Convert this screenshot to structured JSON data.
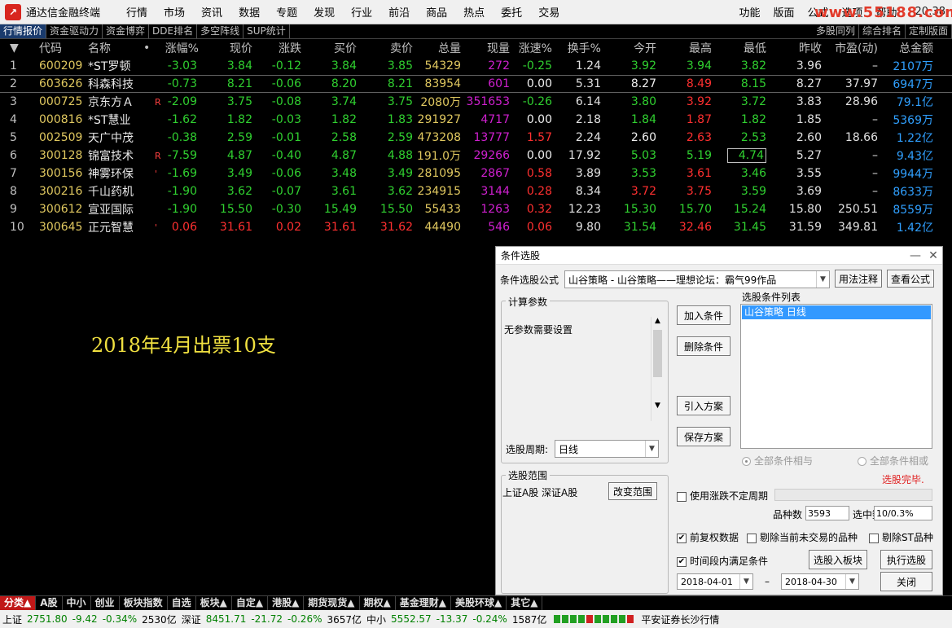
{
  "titlebar": {
    "app_title": "通达信金融终端",
    "menu": [
      "行情",
      "市场",
      "资讯",
      "数据",
      "专题",
      "发现",
      "行业",
      "前沿",
      "商品",
      "热点",
      "委托",
      "交易"
    ],
    "menu_right": [
      "功能",
      "版面",
      "公式",
      "选项",
      "帮助"
    ],
    "clock": "20:38",
    "watermark": "www.55188.com"
  },
  "tabs": {
    "left": [
      "行情报价",
      "资金驱动力",
      "资金博弈",
      "DDE排名",
      "多空阵线",
      "SUP统计"
    ],
    "right": [
      "多股同列",
      "综合排名",
      "定制版面"
    ]
  },
  "table": {
    "headers": {
      "code": "代码",
      "name": "名称",
      "chg": "涨幅%",
      "price": "现价",
      "diff": "涨跌",
      "bid": "买价",
      "ask": "卖价",
      "vol": "总量",
      "cur": "现量",
      "speed": "涨速%",
      "turn": "换手%",
      "open": "今开",
      "high": "最高",
      "low": "最低",
      "prev": "昨收",
      "pe": "市盈(动)",
      "amt": "总金额"
    },
    "rows": [
      {
        "idx": "1",
        "code": "600209",
        "name": "*ST罗顿",
        "mark": "",
        "chg": "-3.03",
        "price": "3.84",
        "diff": "-0.12",
        "bid": "3.84",
        "ask": "3.85",
        "vol": "54329",
        "cur": "272",
        "speed": "-0.25",
        "turn": "1.24",
        "open": "3.92",
        "high": "3.94",
        "low": "3.82",
        "prev": "3.96",
        "pe": "–",
        "amt": "2107万"
      },
      {
        "idx": "2",
        "code": "603626",
        "name": "科森科技",
        "mark": "",
        "chg": "-0.73",
        "price": "8.21",
        "diff": "-0.06",
        "bid": "8.20",
        "ask": "8.21",
        "vol": "83954",
        "cur": "601",
        "speed": "0.00",
        "turn": "5.31",
        "open": "8.27",
        "high": "8.49",
        "low": "8.15",
        "prev": "8.27",
        "pe": "37.97",
        "amt": "6947万"
      },
      {
        "idx": "3",
        "code": "000725",
        "name": "京东方Ａ",
        "mark": "R",
        "chg": "-2.09",
        "price": "3.75",
        "diff": "-0.08",
        "bid": "3.74",
        "ask": "3.75",
        "vol": "2080万",
        "cur": "351653",
        "speed": "-0.26",
        "turn": "6.14",
        "open": "3.80",
        "high": "3.92",
        "low": "3.72",
        "prev": "3.83",
        "pe": "28.96",
        "amt": "79.1亿"
      },
      {
        "idx": "4",
        "code": "000816",
        "name": "*ST慧业",
        "mark": "",
        "chg": "-1.62",
        "price": "1.82",
        "diff": "-0.03",
        "bid": "1.82",
        "ask": "1.83",
        "vol": "291927",
        "cur": "4717",
        "speed": "0.00",
        "turn": "2.18",
        "open": "1.84",
        "high": "1.87",
        "low": "1.82",
        "prev": "1.85",
        "pe": "–",
        "amt": "5369万"
      },
      {
        "idx": "5",
        "code": "002509",
        "name": "天广中茂",
        "mark": "",
        "chg": "-0.38",
        "price": "2.59",
        "diff": "-0.01",
        "bid": "2.58",
        "ask": "2.59",
        "vol": "473208",
        "cur": "13777",
        "speed": "1.57",
        "turn": "2.24",
        "open": "2.60",
        "high": "2.63",
        "low": "2.53",
        "prev": "2.60",
        "pe": "18.66",
        "amt": "1.22亿"
      },
      {
        "idx": "6",
        "code": "300128",
        "name": "锦富技术",
        "mark": "R",
        "chg": "-7.59",
        "price": "4.87",
        "diff": "-0.40",
        "bid": "4.87",
        "ask": "4.88",
        "vol": "191.0万",
        "cur": "29266",
        "speed": "0.00",
        "turn": "17.92",
        "open": "5.03",
        "high": "5.19",
        "low": "4.74",
        "prev": "5.27",
        "pe": "–",
        "amt": "9.43亿"
      },
      {
        "idx": "7",
        "code": "300156",
        "name": "神雾环保",
        "mark": "'",
        "chg": "-1.69",
        "price": "3.49",
        "diff": "-0.06",
        "bid": "3.48",
        "ask": "3.49",
        "vol": "281095",
        "cur": "2867",
        "speed": "0.58",
        "turn": "3.89",
        "open": "3.53",
        "high": "3.61",
        "low": "3.46",
        "prev": "3.55",
        "pe": "–",
        "amt": "9944万"
      },
      {
        "idx": "8",
        "code": "300216",
        "name": "千山药机",
        "mark": "",
        "chg": "-1.90",
        "price": "3.62",
        "diff": "-0.07",
        "bid": "3.61",
        "ask": "3.62",
        "vol": "234915",
        "cur": "3144",
        "speed": "0.28",
        "turn": "8.34",
        "open": "3.72",
        "high": "3.75",
        "low": "3.59",
        "prev": "3.69",
        "pe": "–",
        "amt": "8633万"
      },
      {
        "idx": "9",
        "code": "300612",
        "name": "宣亚国际",
        "mark": "",
        "chg": "-1.90",
        "price": "15.50",
        "diff": "-0.30",
        "bid": "15.49",
        "ask": "15.50",
        "vol": "55433",
        "cur": "1263",
        "speed": "0.32",
        "turn": "12.23",
        "open": "15.30",
        "high": "15.70",
        "low": "15.24",
        "prev": "15.80",
        "pe": "250.51",
        "amt": "8559万"
      },
      {
        "idx": "10",
        "code": "300645",
        "name": "正元智慧",
        "mark": "'",
        "chg": "0.06",
        "price": "31.61",
        "diff": "0.02",
        "bid": "31.61",
        "ask": "31.62",
        "vol": "44490",
        "cur": "546",
        "speed": "0.06",
        "turn": "9.80",
        "open": "31.54",
        "high": "32.46",
        "low": "31.45",
        "prev": "31.59",
        "pe": "349.81",
        "amt": "1.42亿"
      }
    ]
  },
  "annotation": "2018年4月出票10支",
  "bottom_tabs": [
    "分类▲",
    "A股",
    "中小",
    "创业",
    "板块指数",
    "自选",
    "板块▲",
    "自定▲",
    "港股▲",
    "期货现货▲",
    "期权▲",
    "基金理财▲",
    "美股环球▲",
    "其它▲"
  ],
  "status": {
    "sh_label": "上证",
    "sh_value": "2751.80",
    "sh_diff": "-9.42",
    "sh_pct": "-0.34%",
    "sh_amt": "2530亿",
    "sz_label": "深证",
    "sz_value": "8451.71",
    "sz_diff": "-21.72",
    "sz_pct": "-0.26%",
    "sz_amt": "3657亿",
    "zx_label": "中小",
    "zx_value": "5552.57",
    "zx_diff": "-13.37",
    "zx_pct": "-0.24%",
    "zx_amt": "1587亿",
    "broker": "平安证券长沙行情"
  },
  "dialog": {
    "title": "条件选股",
    "formula_label": "条件选股公式",
    "formula_value": "山谷策略       - 山谷策略——理想论坛：霸气99作品",
    "usage_btn": "用法注释",
    "view_btn": "查看公式",
    "params_group": "计算参数",
    "params_text": "无参数需要设置",
    "period_label": "选股周期:",
    "period_value": "日线",
    "add_btn": "加入条件",
    "delete_btn": "删除条件",
    "import_btn": "引入方案",
    "save_btn": "保存方案",
    "cond_list_label": "选股条件列表",
    "cond_item": "山谷策略    日线",
    "radio_and": "全部条件相与",
    "radio_or": "全部条件相或",
    "done_text": "选股完毕.",
    "range_group": "选股范围",
    "range_text": "上证A股  深证A股",
    "range_btn": "改变范围",
    "use_uncertain": "使用涨跌不定周期",
    "count_label": "品种数",
    "count_value": "3593",
    "sel_label": "选中数",
    "sel_value": "10/0.3%",
    "chk_prerestore": "前复权数据",
    "chk_exclude_notrade": "剔除当前未交易的品种",
    "chk_exclude_st": "剔除ST品种",
    "chk_period": "时间段内满足条件",
    "to_block_btn": "选股入板块",
    "run_btn": "执行选股",
    "date_from": "2018-04-01",
    "date_sep": "–",
    "date_to": "2018-04-30",
    "close_btn": "关闭"
  }
}
